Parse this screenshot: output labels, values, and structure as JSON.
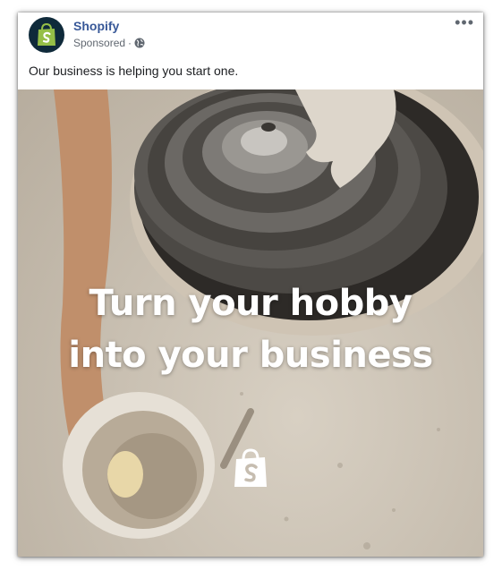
{
  "post": {
    "page_name": "Shopify",
    "sponsored_label": "Sponsored",
    "separator": "·",
    "text": "Our business is helping you start one.",
    "more_icon": "•••",
    "audience_icon": "globe-icon"
  },
  "ad_image": {
    "headline_line1": "Turn your hobby",
    "headline_line2": "into your business",
    "logo_icon": "shopify-bag-icon"
  },
  "colors": {
    "brand_green": "#95bf47",
    "avatar_bg": "#0f2a3a",
    "link_blue": "#385898"
  }
}
